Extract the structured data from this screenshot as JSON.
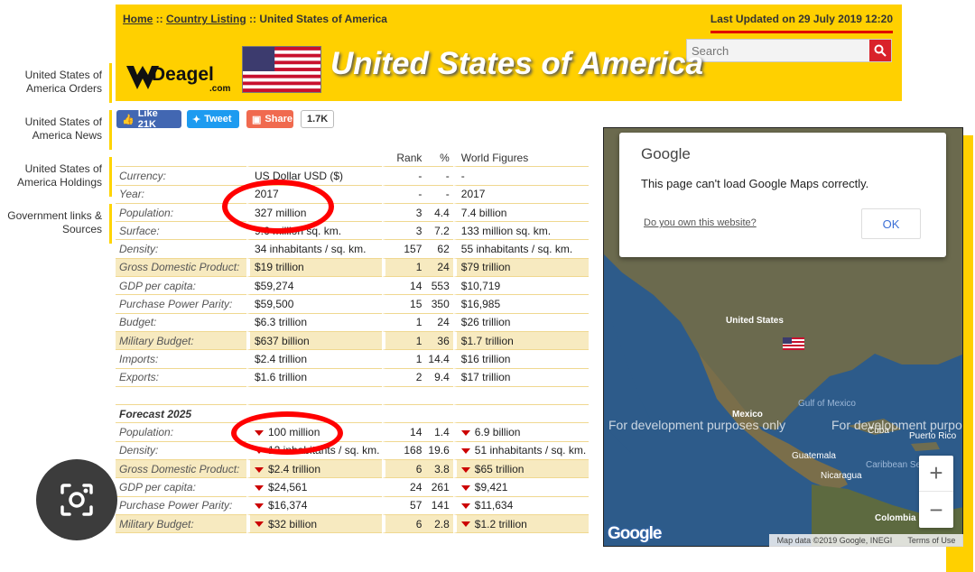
{
  "sidebar": {
    "items": [
      {
        "label": "United States of America Orders"
      },
      {
        "label": "United States of America News"
      },
      {
        "label": "United States of America Holdings"
      },
      {
        "label": "Government links & Sources"
      }
    ]
  },
  "header": {
    "breadcrumb": {
      "home": "Home",
      "sep1": " :: ",
      "country_listing": "Country Listing",
      "sep2": " :: ",
      "current": "United States of America"
    },
    "last_updated": "Last Updated on 29 July 2019 12:20",
    "search_placeholder": "Search",
    "logo_text": "Deagel",
    "logo_sub": ".com",
    "title": "United States of America"
  },
  "social": {
    "like": "Like 21K",
    "tweet": "Tweet",
    "share": "Share",
    "count": "1.7K"
  },
  "table": {
    "headers": {
      "rank": "Rank",
      "pct": "%",
      "world": "World Figures"
    },
    "rows": [
      {
        "label": "Currency:",
        "value": "US Dollar USD ($)",
        "rank": "-",
        "pct": "-",
        "world": "-",
        "hl": false
      },
      {
        "label": "Year:",
        "value": "2017",
        "rank": "-",
        "pct": "-",
        "world": "2017",
        "hl": false
      },
      {
        "label": "Population:",
        "value": "327 million",
        "rank": "3",
        "pct": "4.4",
        "world": "7.4 billion",
        "hl": false
      },
      {
        "label": "Surface:",
        "value": "9.6 million sq. km.",
        "rank": "3",
        "pct": "7.2",
        "world": "133 million sq. km.",
        "hl": false
      },
      {
        "label": "Density:",
        "value": "34 inhabitants / sq. km.",
        "rank": "157",
        "pct": "62",
        "world": "55 inhabitants / sq. km.",
        "hl": false
      },
      {
        "label": "Gross Domestic Product:",
        "value": "$19 trillion",
        "rank": "1",
        "pct": "24",
        "world": "$79 trillion",
        "hl": true
      },
      {
        "label": "GDP per capita:",
        "value": "$59,274",
        "rank": "14",
        "pct": "553",
        "world": "$10,719",
        "hl": false
      },
      {
        "label": "Purchase Power Parity:",
        "value": "$59,500",
        "rank": "15",
        "pct": "350",
        "world": "$16,985",
        "hl": false
      },
      {
        "label": "Budget:",
        "value": "$6.3 trillion",
        "rank": "1",
        "pct": "24",
        "world": "$26 trillion",
        "hl": false
      },
      {
        "label": "Military Budget:",
        "value": "$637 billion",
        "rank": "1",
        "pct": "36",
        "world": "$1.7 trillion",
        "hl": true
      },
      {
        "label": "Imports:",
        "value": "$2.4 trillion",
        "rank": "1",
        "pct": "14.4",
        "world": "$16 trillion",
        "hl": false
      },
      {
        "label": "Exports:",
        "value": "$1.6 trillion",
        "rank": "2",
        "pct": "9.4",
        "world": "$17 trillion",
        "hl": false
      }
    ],
    "forecast_title": "Forecast 2025",
    "forecast_rows": [
      {
        "label": "Population:",
        "value": "100 million",
        "rank": "14",
        "pct": "1.4",
        "world": "6.9 billion",
        "hl": false
      },
      {
        "label": "Density:",
        "value": "12 inhabitants / sq. km.",
        "rank": "168",
        "pct": "19.6",
        "world": "51 inhabitants / sq. km.",
        "hl": false
      },
      {
        "label": "Gross Domestic Product:",
        "value": "$2.4 trillion",
        "rank": "6",
        "pct": "3.8",
        "world": "$65 trillion",
        "hl": true
      },
      {
        "label": "GDP per capita:",
        "value": "$24,561",
        "rank": "24",
        "pct": "261",
        "world": "$9,421",
        "hl": false
      },
      {
        "label": "Purchase Power Parity:",
        "value": "$16,374",
        "rank": "57",
        "pct": "141",
        "world": "$11,634",
        "hl": false
      },
      {
        "label": "Military Budget:",
        "value": "$32 billion",
        "rank": "6",
        "pct": "2.8",
        "world": "$1.2 trillion",
        "hl": true
      }
    ]
  },
  "map": {
    "dialog_brand": "Google",
    "dialog_message": "This page can't load Google Maps correctly.",
    "dialog_link": "Do you own this website?",
    "dialog_ok": "OK",
    "dev_text": "For development purposes only",
    "dev_text_right": "For development purpo",
    "labels": [
      "United States",
      "Mexico",
      "Gulf of Mexico",
      "Cuba",
      "Guatemala",
      "Nicaragua",
      "Colombia",
      "Puerto Rico",
      "Caribbean Sea"
    ],
    "footer_data": "Map data ©2019 Google, INEGI",
    "footer_terms": "Terms of Use",
    "logo": "Google",
    "zoom_in": "+",
    "zoom_out": "−"
  }
}
